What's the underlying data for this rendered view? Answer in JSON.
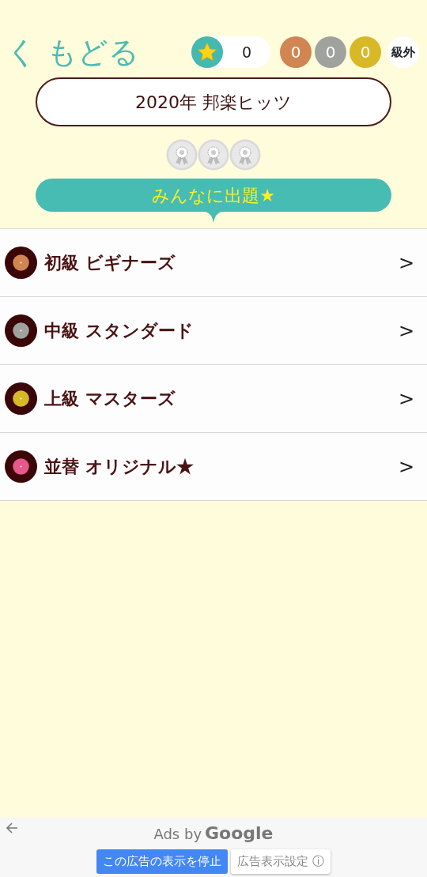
{
  "header": {
    "back_label": "く もどる",
    "star_count": "0",
    "medals": [
      {
        "count": "0",
        "color": "#d08552"
      },
      {
        "count": "0",
        "color": "#a0a29e"
      },
      {
        "count": "0",
        "color": "#d8b827"
      }
    ],
    "rank": "級外"
  },
  "title": "2020年 邦楽ヒッツ",
  "badges": [
    {
      "kind": "rosette"
    },
    {
      "kind": "rosette"
    },
    {
      "kind": "rosette"
    }
  ],
  "share_banner": "みんなに出題★",
  "levels": [
    {
      "label": "初級 ビギナーズ",
      "color": "#d08552",
      "arrow": ">"
    },
    {
      "label": "中級 スタンダード",
      "color": "#a0a29e",
      "arrow": ">"
    },
    {
      "label": "上級 マスターズ",
      "color": "#d8b827",
      "arrow": ">"
    },
    {
      "label": "並替 オリジナル★",
      "color": "#e8588a",
      "arrow": ">"
    }
  ],
  "ad_bar": {
    "label": "Ads by",
    "brand": "Google",
    "stop_button": "この広告の表示を停止",
    "settings_button": "広告表示設定",
    "settings_icon": "ⓘ"
  }
}
